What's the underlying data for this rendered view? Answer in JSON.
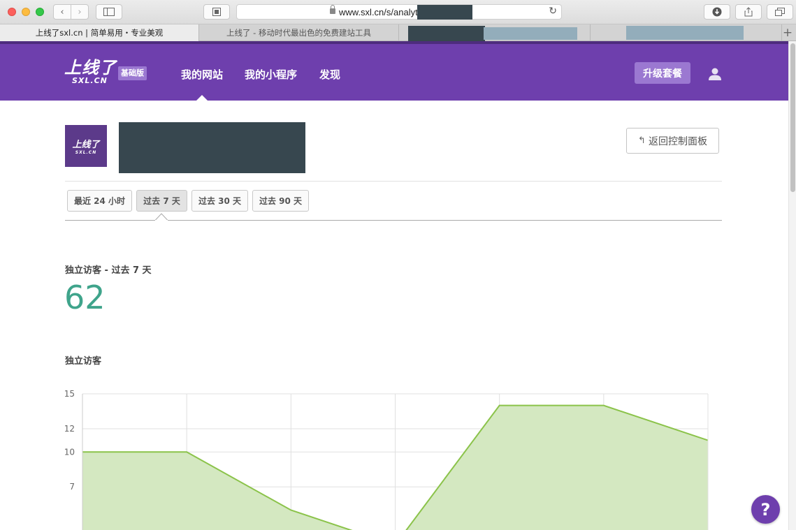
{
  "browser": {
    "url": "www.sxl.cn/s/analyt",
    "tabs": [
      {
        "label": "上线了sxl.cn | 简单易用・专业美观"
      },
      {
        "label": "上线了 - 移动时代最出色的免费建站工具"
      }
    ]
  },
  "nav": {
    "logo_main": "上线了",
    "logo_sub": "SXL.CN",
    "plan_badge": "基础版",
    "items": [
      {
        "label": "我的网站"
      },
      {
        "label": "我的小程序"
      },
      {
        "label": "发现"
      }
    ],
    "upgrade_label": "升级套餐",
    "accent": "#6e3fad"
  },
  "site": {
    "thumb_main": "上线了",
    "thumb_sub": "SXL.CN",
    "back_label": "返回控制面板"
  },
  "periods": [
    {
      "label": "最近 24 小时"
    },
    {
      "label": "过去 7 天"
    },
    {
      "label": "过去 30 天"
    },
    {
      "label": "过去 90 天"
    }
  ],
  "stats": {
    "label": "独立访客 - 过去 7 天",
    "value": "62"
  },
  "chart_title": "独立访客",
  "chart_data": {
    "type": "area",
    "title": "独立访客",
    "y_ticks": [
      "15",
      "12",
      "10",
      "7"
    ],
    "ylim": [
      0,
      15
    ],
    "x": [
      0,
      1,
      2,
      3,
      4,
      5,
      6
    ],
    "values": [
      10,
      10,
      5,
      2,
      14,
      14,
      11
    ],
    "grid": true,
    "line_color": "#8bc34a",
    "fill_color": "#d4e8c1"
  }
}
